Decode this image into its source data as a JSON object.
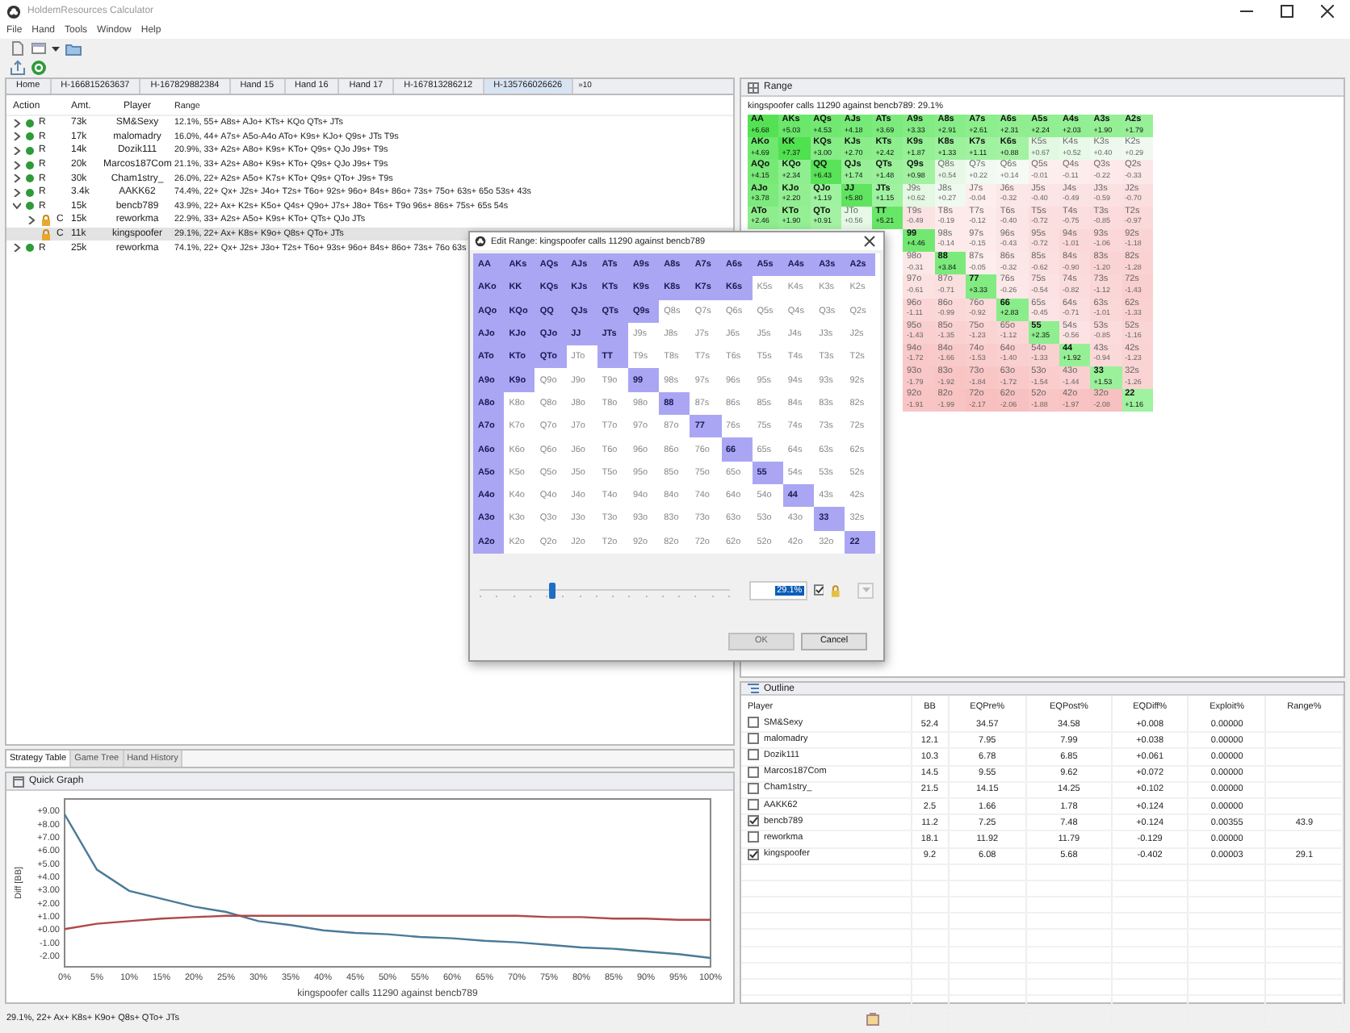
{
  "window": {
    "title": "HoldemResources Calculator"
  },
  "menu": [
    "File",
    "Hand",
    "Tools",
    "Window",
    "Help"
  ],
  "editor_tabs": [
    {
      "label": "Home",
      "selected": false
    },
    {
      "label": "H-166815263637",
      "selected": false
    },
    {
      "label": "H-167829882384",
      "selected": false
    },
    {
      "label": "Hand 15",
      "selected": false
    },
    {
      "label": "Hand 16",
      "selected": false
    },
    {
      "label": "Hand 17",
      "selected": false
    },
    {
      "label": "H-167813286212",
      "selected": false
    },
    {
      "label": "H-135766026626",
      "selected": true
    }
  ],
  "tab_overflow": "»10",
  "action_table": {
    "columns": [
      "Action",
      "Amt.",
      "Player",
      "Range"
    ],
    "rows": [
      {
        "kind": "dot",
        "action": "R",
        "amount": "73k",
        "player": "SM&Sexy",
        "range": "12.1%, 55+ A8s+ AJo+ KTs+ KQo QTs+ JTs",
        "expanded": false,
        "selected": false
      },
      {
        "kind": "dot",
        "action": "R",
        "amount": "17k",
        "player": "malomadry",
        "range": "16.0%, 44+ A7s+ A5o-A4o ATo+ K9s+ KJo+ Q9s+ JTs T9s",
        "expanded": false,
        "selected": false
      },
      {
        "kind": "dot",
        "action": "R",
        "amount": "14k",
        "player": "Dozik111",
        "range": "20.9%, 33+ A2s+ A8o+ K9s+ KTo+ Q9s+ QJo J9s+ T9s",
        "expanded": false,
        "selected": false
      },
      {
        "kind": "dot",
        "action": "R",
        "amount": "20k",
        "player": "Marcos187Com",
        "range": "21.1%, 33+ A2s+ A8o+ K9s+ KTo+ Q9s+ QJo J9s+ T9s",
        "expanded": false,
        "selected": false
      },
      {
        "kind": "dot",
        "action": "R",
        "amount": "30k",
        "player": "Cham1stry_",
        "range": "26.0%, 22+ A2s+ A5o+ K7s+ KTo+ Q9s+ QTo+ J9s+ T9s",
        "expanded": false,
        "selected": false
      },
      {
        "kind": "dot",
        "action": "R",
        "amount": "3.4k",
        "player": "AAKK62",
        "range": "74.4%, 22+ Qx+ J2s+ J4o+ T2s+ T6o+ 92s+ 96o+ 84s+ 86o+ 73s+ 75o+ 63s+ 65o 53s+ 43s",
        "expanded": false,
        "selected": false
      },
      {
        "kind": "dot",
        "action": "R",
        "amount": "15k",
        "player": "bencb789",
        "range": "43.9%, 22+ Ax+ K2s+ K5o+ Q4s+ Q9o+ J7s+ J8o+ T6s+ T9o 96s+ 86s+ 75s+ 65s 54s",
        "expanded": true,
        "selected": false,
        "children": [
          {
            "kind": "lock",
            "action": "C",
            "amount": "15k",
            "player": "reworkma",
            "range": "22.9%, 33+ A2s+ A5o+ K9s+ KTo+ QTs+ QJo JTs",
            "expanded": false,
            "selected": false
          },
          {
            "kind": "lock",
            "action": "C",
            "amount": "11k",
            "player": "kingspoofer",
            "range": "29.1%, 22+ Ax+ K8s+ K9o+ Q8s+ QTo+ JTs",
            "selected": true
          }
        ]
      },
      {
        "kind": "dot",
        "action": "R",
        "amount": "25k",
        "player": "reworkma",
        "range": "74.1%, 22+ Qx+ J2s+ J3o+ T2s+ T6o+ 93s+ 96o+ 84s+ 86o+ 73s+ 76o 63s",
        "expanded": false,
        "selected": false
      }
    ]
  },
  "bottom_tabs": [
    {
      "label": "Strategy Table",
      "selected": true
    },
    {
      "label": "Game Tree",
      "selected": false
    },
    {
      "label": "Hand History",
      "selected": false
    }
  ],
  "quick_graph": {
    "title": "Quick Graph",
    "chart_data": {
      "type": "line",
      "xlabel": "kingspoofer calls 11290 against bencb789",
      "ylabel": "Diff [BB]",
      "x": [
        0,
        5,
        10,
        15,
        20,
        25,
        30,
        35,
        40,
        45,
        50,
        55,
        60,
        65,
        70,
        75,
        80,
        85,
        90,
        95,
        100
      ],
      "series": [
        {
          "color": "#4a7a98",
          "values": [
            8.7,
            4.5,
            2.9,
            2.3,
            1.7,
            1.3,
            0.6,
            0.3,
            -0.1,
            -0.3,
            -0.4,
            -0.6,
            -0.7,
            -0.9,
            -1.0,
            -1.2,
            -1.4,
            -1.5,
            -1.7,
            -1.9,
            -2.2
          ]
        },
        {
          "color": "#b04848",
          "values": [
            0.0,
            0.4,
            0.6,
            0.8,
            0.9,
            1.0,
            1.0,
            1.0,
            1.0,
            1.0,
            1.0,
            1.0,
            1.0,
            1.0,
            1.0,
            0.9,
            0.9,
            0.8,
            0.8,
            0.7,
            0.7
          ]
        }
      ],
      "xlim": [
        0,
        100
      ],
      "ylim": [
        -2.5,
        9.5
      ],
      "xticks": [
        {
          "value": 0,
          "label": "0%"
        },
        {
          "value": 5,
          "label": "5%"
        },
        {
          "value": 10,
          "label": "10%"
        },
        {
          "value": 15,
          "label": "15%"
        },
        {
          "value": 20,
          "label": "20%"
        },
        {
          "value": 25,
          "label": "25%"
        },
        {
          "value": 30,
          "label": "30%"
        },
        {
          "value": 35,
          "label": "35%"
        },
        {
          "value": 40,
          "label": "40%"
        },
        {
          "value": 45,
          "label": "45%"
        },
        {
          "value": 50,
          "label": "50%"
        },
        {
          "value": 55,
          "label": "55%"
        },
        {
          "value": 60,
          "label": "60%"
        },
        {
          "value": 65,
          "label": "65%"
        },
        {
          "value": 70,
          "label": "70%"
        },
        {
          "value": 75,
          "label": "75%"
        },
        {
          "value": 80,
          "label": "80%"
        },
        {
          "value": 85,
          "label": "85%"
        },
        {
          "value": 90,
          "label": "90%"
        },
        {
          "value": 95,
          "label": "95%"
        },
        {
          "value": 100,
          "label": "100%"
        }
      ],
      "yticks": [
        {
          "value": 9,
          "label": "+9.00"
        },
        {
          "value": 8,
          "label": "+8.00"
        },
        {
          "value": 7,
          "label": "+7.00"
        },
        {
          "value": 6,
          "label": "+6.00"
        },
        {
          "value": 5,
          "label": "+5.00"
        },
        {
          "value": 4,
          "label": "+4.00"
        },
        {
          "value": 3,
          "label": "+3.00"
        },
        {
          "value": 2,
          "label": "+2.00"
        },
        {
          "value": 1,
          "label": "+1.00"
        },
        {
          "value": 0,
          "label": "+0.00"
        },
        {
          "value": -1,
          "label": "-1.00"
        },
        {
          "value": -2,
          "label": "-2.00"
        }
      ]
    }
  },
  "status_bar": "29.1%, 22+ Ax+ K8s+ K9o+ Q8s+ QTo+ JTs",
  "range_panel": {
    "title": "Range",
    "subtitle": "kingspoofer calls 11290 against bencb789: 29.1%",
    "grid": [
      [
        {
          "hand": "AA",
          "value": "+6.68",
          "selected": true
        },
        {
          "hand": "AKs",
          "value": "+5.03",
          "selected": true
        },
        {
          "hand": "AQs",
          "value": "+4.53",
          "selected": true
        },
        {
          "hand": "AJs",
          "value": "+4.18",
          "selected": true
        },
        {
          "hand": "ATs",
          "value": "+3.69",
          "selected": true
        },
        {
          "hand": "A9s",
          "value": "+3.33",
          "selected": true
        },
        {
          "hand": "A8s",
          "value": "+2.91",
          "selected": true
        },
        {
          "hand": "A7s",
          "value": "+2.61",
          "selected": true
        },
        {
          "hand": "A6s",
          "value": "+2.31",
          "selected": true
        },
        {
          "hand": "A5s",
          "value": "+2.24",
          "selected": true
        },
        {
          "hand": "A4s",
          "value": "+2.03",
          "selected": true
        },
        {
          "hand": "A3s",
          "value": "+1.90",
          "selected": true
        },
        {
          "hand": "A2s",
          "value": "+1.79",
          "selected": true
        }
      ],
      [
        {
          "hand": "AKo",
          "value": "+4.69",
          "selected": true
        },
        {
          "hand": "KK",
          "value": "+7.37",
          "selected": true
        },
        {
          "hand": "KQs",
          "value": "+3.00",
          "selected": true
        },
        {
          "hand": "KJs",
          "value": "+2.70",
          "selected": true
        },
        {
          "hand": "KTs",
          "value": "+2.42",
          "selected": true
        },
        {
          "hand": "K9s",
          "value": "+1.87",
          "selected": true
        },
        {
          "hand": "K8s",
          "value": "+1.33",
          "selected": true
        },
        {
          "hand": "K7s",
          "value": "+1.11",
          "selected": true
        },
        {
          "hand": "K6s",
          "value": "+0.88",
          "selected": true
        },
        {
          "hand": "K5s",
          "value": "+0.67",
          "selected": false
        },
        {
          "hand": "K4s",
          "value": "+0.52",
          "selected": false
        },
        {
          "hand": "K3s",
          "value": "+0.40",
          "selected": false
        },
        {
          "hand": "K2s",
          "value": "+0.29",
          "selected": false
        }
      ],
      [
        {
          "hand": "AQo",
          "value": "+4.15",
          "selected": true
        },
        {
          "hand": "KQo",
          "value": "+2.34",
          "selected": true
        },
        {
          "hand": "QQ",
          "value": "+6.43",
          "selected": true
        },
        {
          "hand": "QJs",
          "value": "+1.74",
          "selected": true
        },
        {
          "hand": "QTs",
          "value": "+1.48",
          "selected": true
        },
        {
          "hand": "Q9s",
          "value": "+0.98",
          "selected": true
        },
        {
          "hand": "Q8s",
          "value": "+0.54",
          "selected": false
        },
        {
          "hand": "Q7s",
          "value": "+0.22",
          "selected": false
        },
        {
          "hand": "Q6s",
          "value": "+0.14",
          "selected": false
        },
        {
          "hand": "Q5s",
          "value": "-0.01",
          "selected": false
        },
        {
          "hand": "Q4s",
          "value": "-0.11",
          "selected": false
        },
        {
          "hand": "Q3s",
          "value": "-0.22",
          "selected": false
        },
        {
          "hand": "Q2s",
          "value": "-0.33",
          "selected": false
        }
      ],
      [
        {
          "hand": "AJo",
          "value": "+3.78",
          "selected": true
        },
        {
          "hand": "KJo",
          "value": "+2.20",
          "selected": true
        },
        {
          "hand": "QJo",
          "value": "+1.19",
          "selected": true
        },
        {
          "hand": "JJ",
          "value": "+5.80",
          "selected": true
        },
        {
          "hand": "JTs",
          "value": "+1.15",
          "selected": true
        },
        {
          "hand": "J9s",
          "value": "+0.62",
          "selected": false
        },
        {
          "hand": "J8s",
          "value": "+0.27",
          "selected": false
        },
        {
          "hand": "J7s",
          "value": "-0.04",
          "selected": false
        },
        {
          "hand": "J6s",
          "value": "-0.32",
          "selected": false
        },
        {
          "hand": "J5s",
          "value": "-0.40",
          "selected": false
        },
        {
          "hand": "J4s",
          "value": "-0.49",
          "selected": false
        },
        {
          "hand": "J3s",
          "value": "-0.59",
          "selected": false
        },
        {
          "hand": "J2s",
          "value": "-0.70",
          "selected": false
        }
      ],
      [
        {
          "hand": "ATo",
          "value": "+2.46",
          "selected": true
        },
        {
          "hand": "KTo",
          "value": "+1.90",
          "selected": true
        },
        {
          "hand": "QTo",
          "value": "+0.91",
          "selected": true
        },
        {
          "hand": "JTo",
          "value": "+0.56",
          "selected": false
        },
        {
          "hand": "TT",
          "value": "+5.21",
          "selected": true
        },
        {
          "hand": "T9s",
          "value": "-0.49",
          "selected": false
        },
        {
          "hand": "T8s",
          "value": "-0.19",
          "selected": false
        },
        {
          "hand": "T7s",
          "value": "-0.12",
          "selected": false
        },
        {
          "hand": "T6s",
          "value": "-0.40",
          "selected": false
        },
        {
          "hand": "T5s",
          "value": "-0.72",
          "selected": false
        },
        {
          "hand": "T4s",
          "value": "-0.75",
          "selected": false
        },
        {
          "hand": "T3s",
          "value": "-0.85",
          "selected": false
        },
        {
          "hand": "T2s",
          "value": "-0.97",
          "selected": false
        }
      ],
      [
        {
          "hand": "99",
          "value": "+4.46",
          "selected": true
        },
        {
          "hand": "98s",
          "value": "-0.14",
          "selected": false
        },
        {
          "hand": "97s",
          "value": "-0.15",
          "selected": false
        },
        {
          "hand": "96s",
          "value": "-0.43",
          "selected": false
        },
        {
          "hand": "95s",
          "value": "-0.72",
          "selected": false
        },
        {
          "hand": "94s",
          "value": "-1.01",
          "selected": false
        },
        {
          "hand": "93s",
          "value": "-1.06",
          "selected": false
        },
        {
          "hand": "92s",
          "value": "-1.18",
          "selected": false
        }
      ],
      [
        {
          "hand": "98o",
          "value": "-0.31",
          "selected": false
        },
        {
          "hand": "88",
          "value": "+3.84",
          "selected": true
        },
        {
          "hand": "87s",
          "value": "-0.05",
          "selected": false
        },
        {
          "hand": "86s",
          "value": "-0.32",
          "selected": false
        },
        {
          "hand": "85s",
          "value": "-0.62",
          "selected": false
        },
        {
          "hand": "84s",
          "value": "-0.90",
          "selected": false
        },
        {
          "hand": "83s",
          "value": "-1.20",
          "selected": false
        },
        {
          "hand": "82s",
          "value": "-1.28",
          "selected": false
        }
      ],
      [
        {
          "hand": "97o",
          "value": "-0.61",
          "selected": false
        },
        {
          "hand": "87o",
          "value": "-0.71",
          "selected": false
        },
        {
          "hand": "77",
          "value": "+3.33",
          "selected": true
        },
        {
          "hand": "76s",
          "value": "-0.26",
          "selected": false
        },
        {
          "hand": "75s",
          "value": "-0.54",
          "selected": false
        },
        {
          "hand": "74s",
          "value": "-0.82",
          "selected": false
        },
        {
          "hand": "73s",
          "value": "-1.12",
          "selected": false
        },
        {
          "hand": "72s",
          "value": "-1.43",
          "selected": false
        }
      ],
      [
        {
          "hand": "96o",
          "value": "-1.11",
          "selected": false
        },
        {
          "hand": "86o",
          "value": "-0.99",
          "selected": false
        },
        {
          "hand": "76o",
          "value": "-0.92",
          "selected": false
        },
        {
          "hand": "66",
          "value": "+2.83",
          "selected": true
        },
        {
          "hand": "65s",
          "value": "-0.45",
          "selected": false
        },
        {
          "hand": "64s",
          "value": "-0.71",
          "selected": false
        },
        {
          "hand": "63s",
          "value": "-1.01",
          "selected": false
        },
        {
          "hand": "62s",
          "value": "-1.33",
          "selected": false
        }
      ],
      [
        {
          "hand": "95o",
          "value": "-1.43",
          "selected": false
        },
        {
          "hand": "85o",
          "value": "-1.35",
          "selected": false
        },
        {
          "hand": "75o",
          "value": "-1.23",
          "selected": false
        },
        {
          "hand": "65o",
          "value": "-1.12",
          "selected": false
        },
        {
          "hand": "55",
          "value": "+2.35",
          "selected": true
        },
        {
          "hand": "54s",
          "value": "-0.56",
          "selected": false
        },
        {
          "hand": "53s",
          "value": "-0.85",
          "selected": false
        },
        {
          "hand": "52s",
          "value": "-1.16",
          "selected": false
        }
      ],
      [
        {
          "hand": "94o",
          "value": "-1.72",
          "selected": false
        },
        {
          "hand": "84o",
          "value": "-1.66",
          "selected": false
        },
        {
          "hand": "74o",
          "value": "-1.53",
          "selected": false
        },
        {
          "hand": "64o",
          "value": "-1.40",
          "selected": false
        },
        {
          "hand": "54o",
          "value": "-1.33",
          "selected": false
        },
        {
          "hand": "44",
          "value": "+1.92",
          "selected": true
        },
        {
          "hand": "43s",
          "value": "-0.94",
          "selected": false
        },
        {
          "hand": "42s",
          "value": "-1.23",
          "selected": false
        }
      ],
      [
        {
          "hand": "93o",
          "value": "-1.79",
          "selected": false
        },
        {
          "hand": "83o",
          "value": "-1.92",
          "selected": false
        },
        {
          "hand": "73o",
          "value": "-1.84",
          "selected": false
        },
        {
          "hand": "63o",
          "value": "-1.72",
          "selected": false
        },
        {
          "hand": "53o",
          "value": "-1.54",
          "selected": false
        },
        {
          "hand": "43o",
          "value": "-1.44",
          "selected": false
        },
        {
          "hand": "33",
          "value": "+1.53",
          "selected": true
        },
        {
          "hand": "32s",
          "value": "-1.26",
          "selected": false
        }
      ],
      [
        {
          "hand": "92o",
          "value": "-1.91",
          "selected": false
        },
        {
          "hand": "82o",
          "value": "-1.99",
          "selected": false
        },
        {
          "hand": "72o",
          "value": "-2.17",
          "selected": false
        },
        {
          "hand": "62o",
          "value": "-2.06",
          "selected": false
        },
        {
          "hand": "52o",
          "value": "-1.88",
          "selected": false
        },
        {
          "hand": "42o",
          "value": "-1.97",
          "selected": false
        },
        {
          "hand": "32o",
          "value": "-2.08",
          "selected": false
        },
        {
          "hand": "22",
          "value": "+1.16",
          "selected": true
        }
      ]
    ]
  },
  "outline": {
    "title": "Outline",
    "columns": [
      "Player",
      "BB",
      "EQPre%",
      "EQPost%",
      "EQDiff%",
      "Exploit%",
      "Range%"
    ],
    "rows": [
      {
        "player": "SM&Sexy",
        "checked": false,
        "bb": "52.4",
        "eq_pre": "34.57",
        "eq_post": "34.58",
        "eq_diff": "+0.008",
        "exploit": "0.00000"
      },
      {
        "player": "malomadry",
        "checked": false,
        "bb": "12.1",
        "eq_pre": "7.95",
        "eq_post": "7.99",
        "eq_diff": "+0.038",
        "exploit": "0.00000"
      },
      {
        "player": "Dozik111",
        "checked": false,
        "bb": "10.3",
        "eq_pre": "6.78",
        "eq_post": "6.85",
        "eq_diff": "+0.061",
        "exploit": "0.00000"
      },
      {
        "player": "Marcos187Com",
        "checked": false,
        "bb": "14.5",
        "eq_pre": "9.55",
        "eq_post": "9.62",
        "eq_diff": "+0.072",
        "exploit": "0.00000"
      },
      {
        "player": "Cham1stry_",
        "checked": false,
        "bb": "21.5",
        "eq_pre": "14.15",
        "eq_post": "14.25",
        "eq_diff": "+0.102",
        "exploit": "0.00000"
      },
      {
        "player": "AAKK62",
        "checked": false,
        "bb": "2.5",
        "eq_pre": "1.66",
        "eq_post": "1.78",
        "eq_diff": "+0.124",
        "exploit": "0.00000"
      },
      {
        "player": "bencb789",
        "checked": true,
        "bb": "11.2",
        "eq_pre": "7.25",
        "eq_post": "7.48",
        "eq_diff": "+0.124",
        "exploit": "0.00355",
        "range": "43.9"
      },
      {
        "player": "reworkma",
        "checked": false,
        "bb": "18.1",
        "eq_pre": "11.92",
        "eq_post": "11.79",
        "eq_diff": "-0.129",
        "exploit": "0.00000"
      },
      {
        "player": "kingspoofer",
        "checked": true,
        "bb": "9.2",
        "eq_pre": "6.08",
        "eq_post": "5.68",
        "eq_diff": "-0.402",
        "exploit": "0.00003",
        "range": "29.1"
      }
    ]
  },
  "dialog": {
    "title": "Edit Range: kingspoofer calls 11290 against bencb789",
    "grid": [
      [
        {
          "hand": "AA",
          "selected": true
        },
        {
          "hand": "AKs",
          "selected": true
        },
        {
          "hand": "AQs",
          "selected": true
        },
        {
          "hand": "AJs",
          "selected": true
        },
        {
          "hand": "ATs",
          "selected": true
        },
        {
          "hand": "A9s",
          "selected": true
        },
        {
          "hand": "A8s",
          "selected": true
        },
        {
          "hand": "A7s",
          "selected": true
        },
        {
          "hand": "A6s",
          "selected": true
        },
        {
          "hand": "A5s",
          "selected": true
        },
        {
          "hand": "A4s",
          "selected": true
        },
        {
          "hand": "A3s",
          "selected": true
        },
        {
          "hand": "A2s",
          "selected": true
        }
      ],
      [
        {
          "hand": "AKo",
          "selected": true
        },
        {
          "hand": "KK",
          "selected": true
        },
        {
          "hand": "KQs",
          "selected": true
        },
        {
          "hand": "KJs",
          "selected": true
        },
        {
          "hand": "KTs",
          "selected": true
        },
        {
          "hand": "K9s",
          "selected": true
        },
        {
          "hand": "K8s",
          "selected": true
        },
        {
          "hand": "K7s",
          "selected": true
        },
        {
          "hand": "K6s",
          "selected": true
        },
        {
          "hand": "K5s",
          "selected": false
        },
        {
          "hand": "K4s",
          "selected": false
        },
        {
          "hand": "K3s",
          "selected": false
        },
        {
          "hand": "K2s",
          "selected": false
        }
      ],
      [
        {
          "hand": "AQo",
          "selected": true
        },
        {
          "hand": "KQo",
          "selected": true
        },
        {
          "hand": "QQ",
          "selected": true
        },
        {
          "hand": "QJs",
          "selected": true
        },
        {
          "hand": "QTs",
          "selected": true
        },
        {
          "hand": "Q9s",
          "selected": true
        },
        {
          "hand": "Q8s",
          "selected": false
        },
        {
          "hand": "Q7s",
          "selected": false
        },
        {
          "hand": "Q6s",
          "selected": false
        },
        {
          "hand": "Q5s",
          "selected": false
        },
        {
          "hand": "Q4s",
          "selected": false
        },
        {
          "hand": "Q3s",
          "selected": false
        },
        {
          "hand": "Q2s",
          "selected": false
        }
      ],
      [
        {
          "hand": "AJo",
          "selected": true
        },
        {
          "hand": "KJo",
          "selected": true
        },
        {
          "hand": "QJo",
          "selected": true
        },
        {
          "hand": "JJ",
          "selected": true
        },
        {
          "hand": "JTs",
          "selected": true
        },
        {
          "hand": "J9s",
          "selected": false
        },
        {
          "hand": "J8s",
          "selected": false
        },
        {
          "hand": "J7s",
          "selected": false
        },
        {
          "hand": "J6s",
          "selected": false
        },
        {
          "hand": "J5s",
          "selected": false
        },
        {
          "hand": "J4s",
          "selected": false
        },
        {
          "hand": "J3s",
          "selected": false
        },
        {
          "hand": "J2s",
          "selected": false
        }
      ],
      [
        {
          "hand": "ATo",
          "selected": true
        },
        {
          "hand": "KTo",
          "selected": true
        },
        {
          "hand": "QTo",
          "selected": true
        },
        {
          "hand": "JTo",
          "selected": false
        },
        {
          "hand": "TT",
          "selected": true
        },
        {
          "hand": "T9s",
          "selected": false
        },
        {
          "hand": "T8s",
          "selected": false
        },
        {
          "hand": "T7s",
          "selected": false
        },
        {
          "hand": "T6s",
          "selected": false
        },
        {
          "hand": "T5s",
          "selected": false
        },
        {
          "hand": "T4s",
          "selected": false
        },
        {
          "hand": "T3s",
          "selected": false
        },
        {
          "hand": "T2s",
          "selected": false
        }
      ],
      [
        {
          "hand": "A9o",
          "selected": true
        },
        {
          "hand": "K9o",
          "selected": true
        },
        {
          "hand": "Q9o",
          "selected": false
        },
        {
          "hand": "J9o",
          "selected": false
        },
        {
          "hand": "T9o",
          "selected": false
        },
        {
          "hand": "99",
          "selected": true
        },
        {
          "hand": "98s",
          "selected": false
        },
        {
          "hand": "97s",
          "selected": false
        },
        {
          "hand": "96s",
          "selected": false
        },
        {
          "hand": "95s",
          "selected": false
        },
        {
          "hand": "94s",
          "selected": false
        },
        {
          "hand": "93s",
          "selected": false
        },
        {
          "hand": "92s",
          "selected": false
        }
      ],
      [
        {
          "hand": "A8o",
          "selected": true
        },
        {
          "hand": "K8o",
          "selected": false
        },
        {
          "hand": "Q8o",
          "selected": false
        },
        {
          "hand": "J8o",
          "selected": false
        },
        {
          "hand": "T8o",
          "selected": false
        },
        {
          "hand": "98o",
          "selected": false
        },
        {
          "hand": "88",
          "selected": true
        },
        {
          "hand": "87s",
          "selected": false
        },
        {
          "hand": "86s",
          "selected": false
        },
        {
          "hand": "85s",
          "selected": false
        },
        {
          "hand": "84s",
          "selected": false
        },
        {
          "hand": "83s",
          "selected": false
        },
        {
          "hand": "82s",
          "selected": false
        }
      ],
      [
        {
          "hand": "A7o",
          "selected": true
        },
        {
          "hand": "K7o",
          "selected": false
        },
        {
          "hand": "Q7o",
          "selected": false
        },
        {
          "hand": "J7o",
          "selected": false
        },
        {
          "hand": "T7o",
          "selected": false
        },
        {
          "hand": "97o",
          "selected": false
        },
        {
          "hand": "87o",
          "selected": false
        },
        {
          "hand": "77",
          "selected": true
        },
        {
          "hand": "76s",
          "selected": false
        },
        {
          "hand": "75s",
          "selected": false
        },
        {
          "hand": "74s",
          "selected": false
        },
        {
          "hand": "73s",
          "selected": false
        },
        {
          "hand": "72s",
          "selected": false
        }
      ],
      [
        {
          "hand": "A6o",
          "selected": true
        },
        {
          "hand": "K6o",
          "selected": false
        },
        {
          "hand": "Q6o",
          "selected": false
        },
        {
          "hand": "J6o",
          "selected": false
        },
        {
          "hand": "T6o",
          "selected": false
        },
        {
          "hand": "96o",
          "selected": false
        },
        {
          "hand": "86o",
          "selected": false
        },
        {
          "hand": "76o",
          "selected": false
        },
        {
          "hand": "66",
          "selected": true
        },
        {
          "hand": "65s",
          "selected": false
        },
        {
          "hand": "64s",
          "selected": false
        },
        {
          "hand": "63s",
          "selected": false
        },
        {
          "hand": "62s",
          "selected": false
        }
      ],
      [
        {
          "hand": "A5o",
          "selected": true
        },
        {
          "hand": "K5o",
          "selected": false
        },
        {
          "hand": "Q5o",
          "selected": false
        },
        {
          "hand": "J5o",
          "selected": false
        },
        {
          "hand": "T5o",
          "selected": false
        },
        {
          "hand": "95o",
          "selected": false
        },
        {
          "hand": "85o",
          "selected": false
        },
        {
          "hand": "75o",
          "selected": false
        },
        {
          "hand": "65o",
          "selected": false
        },
        {
          "hand": "55",
          "selected": true
        },
        {
          "hand": "54s",
          "selected": false
        },
        {
          "hand": "53s",
          "selected": false
        },
        {
          "hand": "52s",
          "selected": false
        }
      ],
      [
        {
          "hand": "A4o",
          "selected": true
        },
        {
          "hand": "K4o",
          "selected": false
        },
        {
          "hand": "Q4o",
          "selected": false
        },
        {
          "hand": "J4o",
          "selected": false
        },
        {
          "hand": "T4o",
          "selected": false
        },
        {
          "hand": "94o",
          "selected": false
        },
        {
          "hand": "84o",
          "selected": false
        },
        {
          "hand": "74o",
          "selected": false
        },
        {
          "hand": "64o",
          "selected": false
        },
        {
          "hand": "54o",
          "selected": false
        },
        {
          "hand": "44",
          "selected": true
        },
        {
          "hand": "43s",
          "selected": false
        },
        {
          "hand": "42s",
          "selected": false
        }
      ],
      [
        {
          "hand": "A3o",
          "selected": true
        },
        {
          "hand": "K3o",
          "selected": false
        },
        {
          "hand": "Q3o",
          "selected": false
        },
        {
          "hand": "J3o",
          "selected": false
        },
        {
          "hand": "T3o",
          "selected": false
        },
        {
          "hand": "93o",
          "selected": false
        },
        {
          "hand": "83o",
          "selected": false
        },
        {
          "hand": "73o",
          "selected": false
        },
        {
          "hand": "63o",
          "selected": false
        },
        {
          "hand": "53o",
          "selected": false
        },
        {
          "hand": "43o",
          "selected": false
        },
        {
          "hand": "33",
          "selected": true
        },
        {
          "hand": "32s",
          "selected": false
        }
      ],
      [
        {
          "hand": "A2o",
          "selected": true
        },
        {
          "hand": "K2o",
          "selected": false
        },
        {
          "hand": "Q2o",
          "selected": false
        },
        {
          "hand": "J2o",
          "selected": false
        },
        {
          "hand": "T2o",
          "selected": false
        },
        {
          "hand": "92o",
          "selected": false
        },
        {
          "hand": "82o",
          "selected": false
        },
        {
          "hand": "72o",
          "selected": false
        },
        {
          "hand": "62o",
          "selected": false
        },
        {
          "hand": "52o",
          "selected": false
        },
        {
          "hand": "42o",
          "selected": false
        },
        {
          "hand": "32o",
          "selected": false
        },
        {
          "hand": "22",
          "selected": true
        }
      ]
    ],
    "slider": {
      "level": 0.29
    },
    "percent_field": {
      "value": "29.1%"
    },
    "lock_checkbox": {
      "checked": true
    },
    "dropdown": {
      "disabled": true
    },
    "buttons": [
      {
        "label": "OK",
        "disabled": true
      },
      {
        "label": "Cancel",
        "disabled": false
      }
    ]
  }
}
